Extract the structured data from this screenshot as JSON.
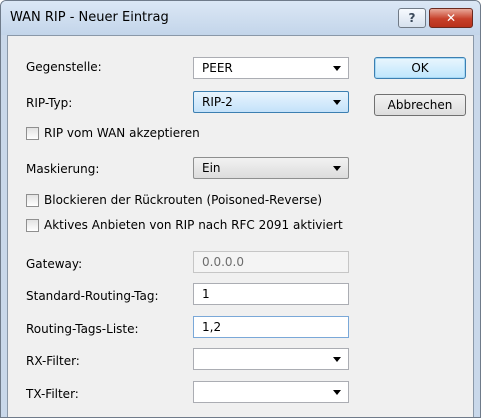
{
  "window": {
    "title": "WAN RIP - Neuer Eintrag",
    "help_glyph": "?",
    "close_glyph": "✕"
  },
  "buttons": {
    "ok": "OK",
    "cancel": "Abbrechen"
  },
  "form": {
    "gegenstelle": {
      "label": "Gegenstelle:",
      "value": "PEER"
    },
    "rip_typ": {
      "label": "RIP-Typ:",
      "value": "RIP-2"
    },
    "rip_wan": {
      "label": "RIP vom WAN akzeptieren",
      "checked": false
    },
    "maskierung": {
      "label": "Maskierung:",
      "value": "Ein"
    },
    "poisoned_reverse": {
      "label": "Blockieren der Rückrouten (Poisoned-Reverse)",
      "checked": false
    },
    "rfc2091": {
      "label": "Aktives Anbieten von RIP nach RFC 2091 aktiviert",
      "checked": false
    },
    "gateway": {
      "label": "Gateway:",
      "value": "0.0.0.0"
    },
    "standard_routing_tag": {
      "label": "Standard-Routing-Tag:",
      "value": "1"
    },
    "routing_tags_liste": {
      "label": "Routing-Tags-Liste:",
      "value": "1,2"
    },
    "rx_filter": {
      "label": "RX-Filter:",
      "value": ""
    },
    "tx_filter": {
      "label": "TX-Filter:",
      "value": ""
    }
  }
}
